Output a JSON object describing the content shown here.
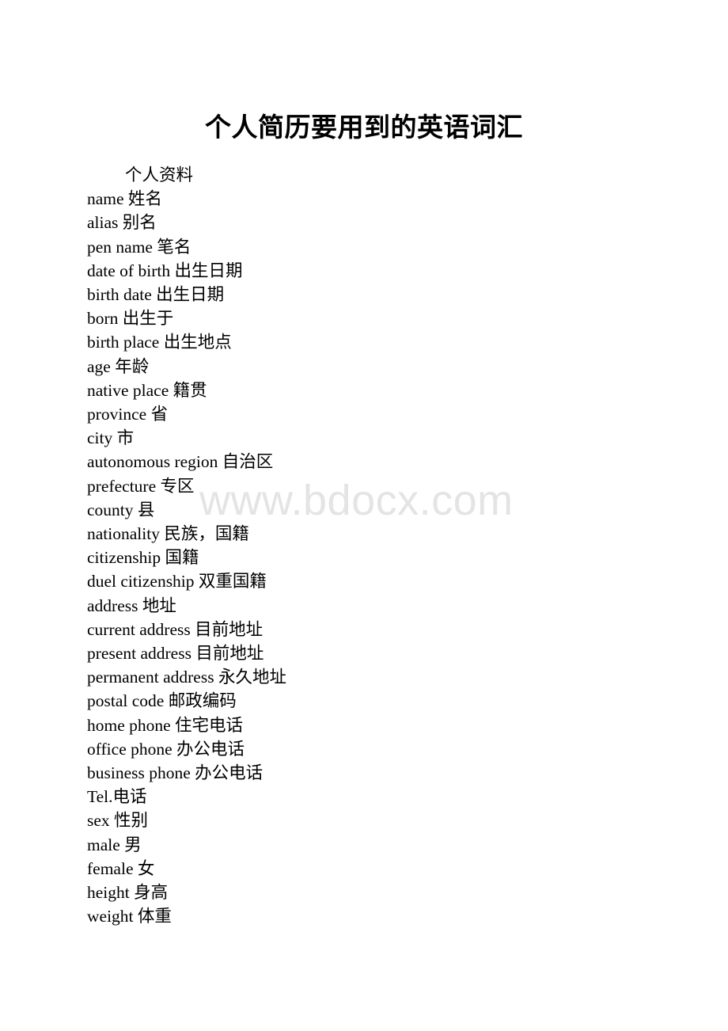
{
  "document": {
    "title": "个人简历要用到的英语词汇",
    "watermark": "www.bdocx.com",
    "watermark_color": "#e4e4e4",
    "text_color": "#000000",
    "background_color": "#ffffff",
    "section_heading": "个人资料",
    "entries": [
      "name 姓名",
      "alias 别名",
      "pen name 笔名",
      "date of birth 出生日期",
      "birth date 出生日期",
      "born 出生于",
      "birth place 出生地点",
      "age 年龄",
      "native place 籍贯",
      "province 省",
      "city 市",
      "autonomous region 自治区",
      "prefecture 专区",
      "county 县",
      "nationality 民族，国籍",
      "citizenship 国籍",
      "duel citizenship 双重国籍",
      "address 地址",
      "current address 目前地址",
      "present address 目前地址",
      "permanent address 永久地址",
      "postal code 邮政编码",
      "home phone 住宅电话",
      "office phone 办公电话",
      "business phone 办公电话",
      "Tel.电话",
      "sex 性别",
      "male 男",
      "female 女",
      "height 身高",
      "weight 体重"
    ]
  }
}
